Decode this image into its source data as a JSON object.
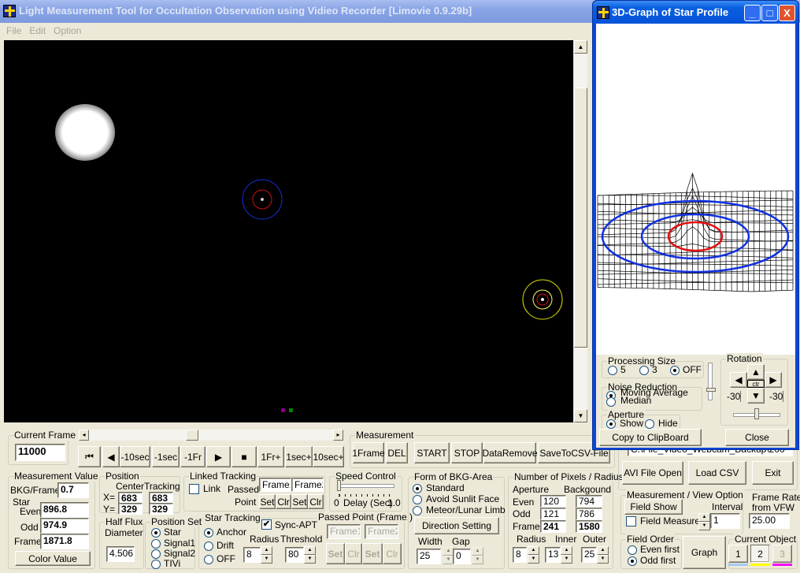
{
  "main_window": {
    "title": "Light Measurement Tool for Occultation Observation using Vidieo Recorder [Limovie 0.9.29b]",
    "menu": [
      "File",
      "Edit",
      "Option"
    ]
  },
  "popup": {
    "title": "3D-Graph of Star Profile",
    "minimize": "_",
    "maximize": "□",
    "close": "X",
    "processing_size": {
      "label": "Processing Size",
      "options": [
        "5",
        "3",
        "OFF"
      ],
      "selected": "OFF"
    },
    "noise_reduction": {
      "label": "Noise Reduction",
      "options": [
        "Moving Average",
        "Median"
      ],
      "selected": "Moving Average"
    },
    "aperture": {
      "label": "Aperture",
      "options": [
        "Show",
        "Hide"
      ],
      "selected": "Show"
    },
    "rotation": {
      "label": "Rotation",
      "up": "▲",
      "down": "▼",
      "left": "◀",
      "right": "▶",
      "center": "ctr",
      "value_left": "-30",
      "value_right": "-30"
    },
    "copy_button": "Copy to ClipBoard",
    "close_button": "Close"
  },
  "current_frame": {
    "label": "Current Frame",
    "value": "11000"
  },
  "playback": {
    "buttons": [
      "⏮",
      "◀",
      "-10sec",
      "-1sec",
      "-1Fr",
      "▶",
      "■",
      "1Fr+",
      "1sec+",
      "10sec+"
    ],
    "scroll_left": "◂",
    "scroll_right": "▸"
  },
  "measurement": {
    "label": "Measurement",
    "buttons": [
      "1Frame",
      "DEL",
      "START",
      "STOP",
      "DataRemove",
      "SaveToCSV-File"
    ]
  },
  "measurement_value": {
    "label": "Measurement Value",
    "bkg_label": "BKG/Frame",
    "bkg": "0.7",
    "star_label": "Star",
    "even_label": "Even",
    "even": "896.8",
    "odd_label": "Odd",
    "odd": "974.9",
    "frame_label": "Frame",
    "frame": "1871.8",
    "color_button": "Color Value"
  },
  "position": {
    "label": "Position",
    "center_label": "Center",
    "tracking_label": "Tracking",
    "x_label": "X=",
    "y_label": "Y=",
    "center_x": "683",
    "center_y": "329",
    "tracking_x": "683",
    "tracking_y": "329"
  },
  "half_flux": {
    "label": "Half Flux",
    "label2": "Diameter",
    "value": "4.506"
  },
  "position_set": {
    "label": "Position Set",
    "options": [
      "Star",
      "Signal1",
      "Signal2",
      "TIVi"
    ],
    "selected": "Star"
  },
  "linked_tracking": {
    "label": "Linked Tracking",
    "link_label": "Link",
    "link_checked": false,
    "passed_label": "Passed-",
    "point_label": "Point",
    "frame1": "Frame1",
    "frame2": "Frame2",
    "set": "Set",
    "clr": "Clr"
  },
  "speed_control": {
    "label": "Speed Control",
    "min": "0",
    "caption": "Delay (Sec)",
    "max": "1.0",
    "value": 0
  },
  "star_tracking": {
    "label": "Star Tracking",
    "options": [
      "Anchor",
      "Drift",
      "OFF"
    ],
    "selected": "Anchor",
    "sync_apt_label": "Sync-APT",
    "sync_apt": true,
    "radius_label": "Radius",
    "radius": "8",
    "threshold_label": "Threshold",
    "threshold": "80"
  },
  "passed_point": {
    "label": "Passed Point (Frame.)",
    "frame1": "Frame1",
    "frame2": "Frame2",
    "set": "Set",
    "clr": "Clr"
  },
  "bkg_area": {
    "label": "Form of BKG-Area",
    "options": [
      "Standard",
      "Avoid Sunlit Face",
      "Meteor/Lunar Limb"
    ],
    "selected": "Standard",
    "direction_button": "Direction Setting",
    "width_label": "Width",
    "width": "25",
    "gap_label": "Gap",
    "gap": "0"
  },
  "pixels": {
    "label": "Number of Pixels / Radius",
    "aperture_label": "Aperture",
    "background_label": "Backgound",
    "even_label": "Even",
    "odd_label": "Odd",
    "frame_label": "Frame",
    "ap_even": "120",
    "ap_odd": "121",
    "ap_frame": "241",
    "bg_even": "794",
    "bg_odd": "786",
    "bg_frame": "1580",
    "radius_label": "Radius",
    "radius": "8",
    "inner_label": "Inner",
    "inner": "13",
    "outer_label": "Outer",
    "outer": "25"
  },
  "file": {
    "path": "C:\\File_Video_Webcam_Backup\\200",
    "avi_button": "AVI File Open",
    "csv_button": "Load CSV",
    "exit_button": "Exit"
  },
  "view_option": {
    "label": "Measurement / View Option",
    "field_show": "Field Show",
    "interval_label": "Interval",
    "interval": "1",
    "field_measure_label": "Field Measure",
    "field_measure": false
  },
  "frame_rate": {
    "label": "Frame Rate",
    "label2": "from VFW",
    "value": "25.00"
  },
  "field_order": {
    "label": "Field Order",
    "options": [
      "Even first",
      "Odd first"
    ],
    "selected": "Odd first"
  },
  "graph_button": "Graph",
  "current_object": {
    "label": "Current Object",
    "options": [
      "1",
      "2",
      "3"
    ],
    "selected": "2",
    "colors": [
      "#a6caf0",
      "#ffff00",
      "#ff00ff"
    ]
  }
}
